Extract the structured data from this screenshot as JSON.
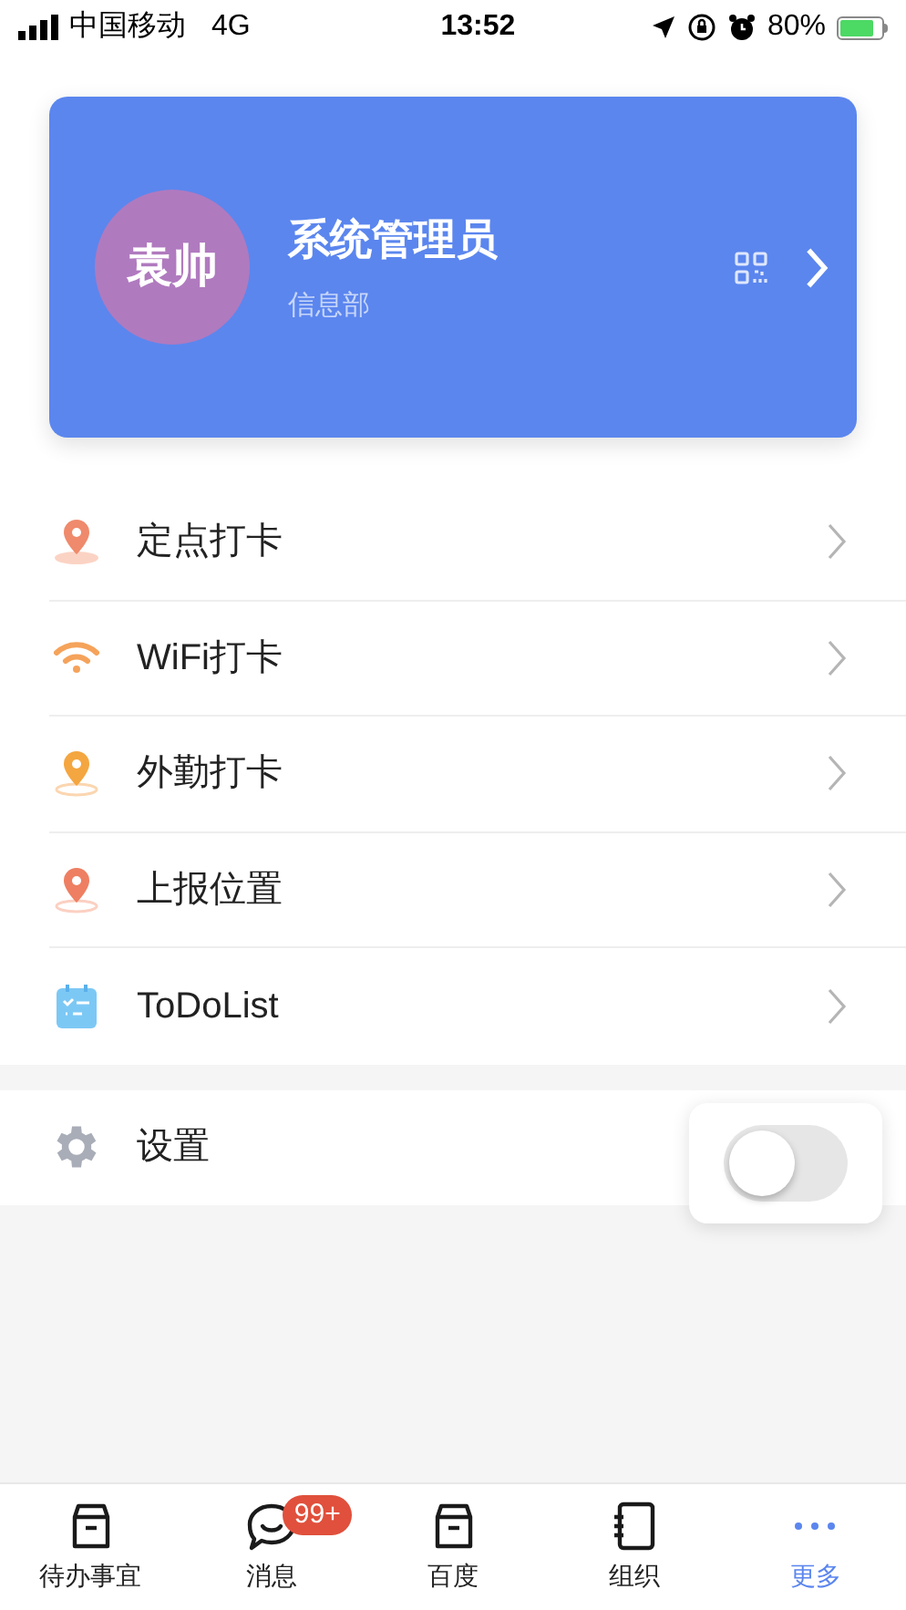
{
  "status_bar": {
    "carrier": "中国移动",
    "network": "4G",
    "time": "13:52",
    "battery": "80%"
  },
  "profile": {
    "avatar": "袁帅",
    "name": "系统管理员",
    "department": "信息部"
  },
  "menu": [
    {
      "kind": "pin-map",
      "label": "定点打卡"
    },
    {
      "kind": "wifi",
      "label": "WiFi打卡"
    },
    {
      "kind": "pin-yellow",
      "label": "外勤打卡"
    },
    {
      "kind": "pin-red",
      "label": "上报位置"
    },
    {
      "kind": "calendar",
      "label": "ToDoList"
    }
  ],
  "settings": {
    "label": "设置",
    "toggle_on": false
  },
  "tabs": [
    {
      "kind": "box",
      "label": "待办事宜",
      "selected": false
    },
    {
      "kind": "chat",
      "label": "消息",
      "selected": false,
      "badge": "99+"
    },
    {
      "kind": "box",
      "label": "百度",
      "selected": false
    },
    {
      "kind": "notebook",
      "label": "组织",
      "selected": false
    },
    {
      "kind": "dots",
      "label": "更多",
      "selected": true
    }
  ]
}
